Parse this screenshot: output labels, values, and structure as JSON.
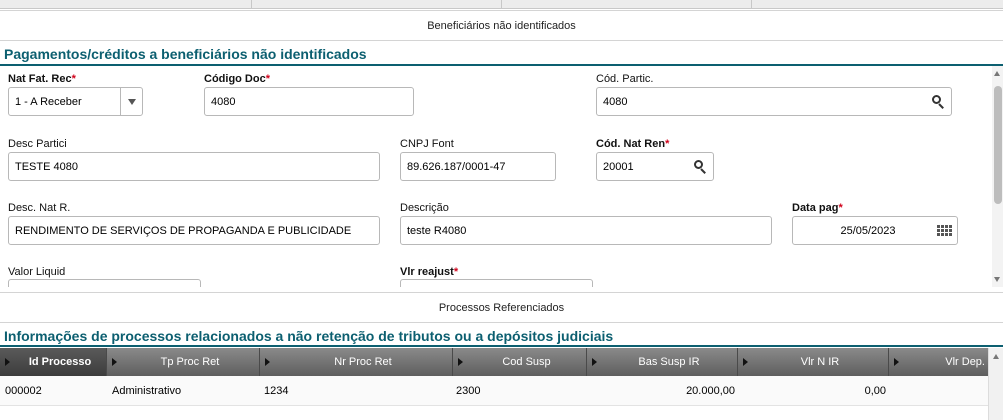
{
  "tabs": {
    "beneficiarios": "Beneficiários não identificados",
    "processos": "Processos Referenciados"
  },
  "section1": {
    "title": "Pagamentos/créditos a beneficiários não identificados"
  },
  "form": {
    "nat_fat_rec": {
      "label": "Nat Fat. Rec",
      "required": "*",
      "value": "1 - A Receber"
    },
    "codigo_doc": {
      "label": "Código Doc",
      "required": "*",
      "value": "4080"
    },
    "cod_partic": {
      "label": "Cód. Partic.",
      "value": "4080"
    },
    "desc_partici": {
      "label": "Desc Partici",
      "value": "TESTE 4080"
    },
    "cnpj_font": {
      "label": "CNPJ Font",
      "value": "89.626.187/0001-47"
    },
    "cod_nat_ren": {
      "label": "Cód. Nat Ren",
      "required": "*",
      "value": "20001"
    },
    "desc_nat_r": {
      "label": "Desc. Nat R.",
      "value": "RENDIMENTO DE SERVIÇOS DE PROPAGANDA E PUBLICIDADE"
    },
    "descricao": {
      "label": "Descrição",
      "value": "teste R4080"
    },
    "data_pag": {
      "label": "Data pag",
      "required": "*",
      "value": "25/05/2023"
    },
    "valor_liquid": {
      "label": "Valor Liquid",
      "value": ""
    },
    "vlr_reajust": {
      "label": "Vlr reajust",
      "required": "*",
      "value": ""
    }
  },
  "section2": {
    "title": "Informações de processos relacionados a não retenção de tributos ou a depósitos judiciais"
  },
  "grid": {
    "columns": [
      "Id Processo",
      "Tp Proc Ret",
      "Nr Proc Ret",
      "Cod Susp",
      "Bas Susp IR",
      "Vlr N IR",
      "Vlr Dep."
    ],
    "rows": [
      [
        "000002",
        "Administrativo",
        "1234",
        "2300",
        "20.000,00",
        "0,00",
        ""
      ]
    ]
  },
  "icons": {
    "dropdown": "chevron-down-icon",
    "lookup": "search-icon",
    "calendar": "calendar-icon",
    "column_sort": "column-arrow-icon"
  },
  "colors": {
    "section_title": "#0c5f70",
    "required_marker": "#d0021b",
    "grid_header": "#6e6e6e"
  }
}
